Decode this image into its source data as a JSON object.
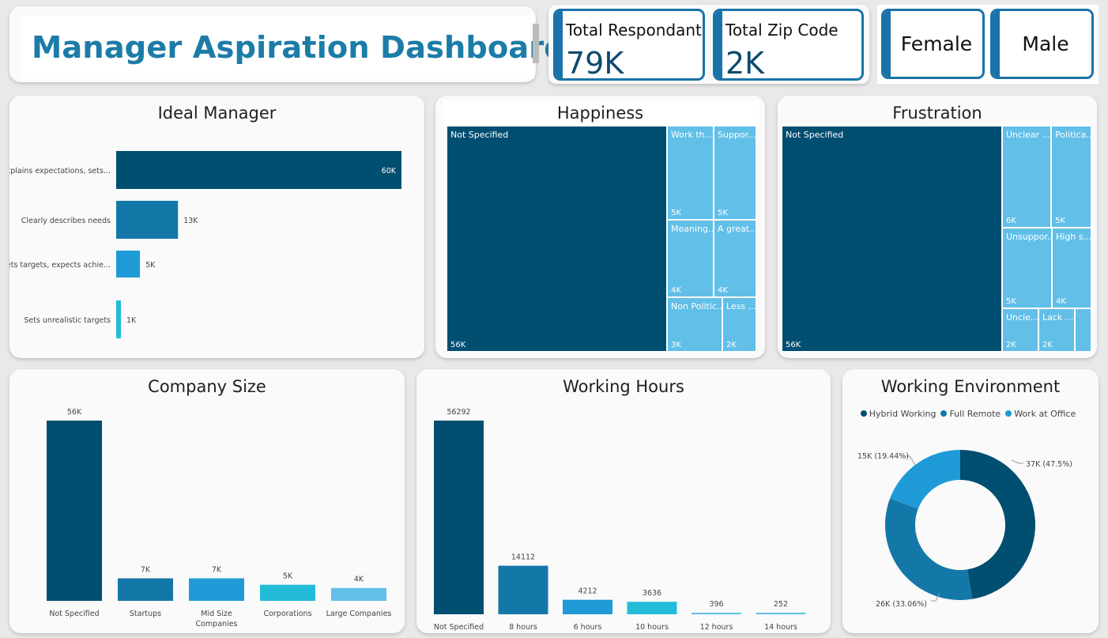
{
  "title": "Manager Aspiration Dashboard",
  "kpis": {
    "respondants": {
      "label": "Total Respondant",
      "value": "79K"
    },
    "zipcodes": {
      "label": "Total Zip Code",
      "value": "2K"
    }
  },
  "filters": {
    "female": "Female",
    "male": "Male"
  },
  "colors": {
    "dark": "#004e70",
    "mid": "#1378a8",
    "light": "#1e9bd6",
    "cyan": "#22bcd8",
    "pale": "#61bfe8",
    "accent": "#1a73a8"
  },
  "ideal_manager": {
    "title": "Ideal Manager",
    "chart_data": {
      "type": "bar",
      "orientation": "horizontal",
      "categories": [
        "Explains expectations, sets...",
        "Clearly describes needs",
        "Sets targets, expects achie...",
        "Sets unrealistic targets"
      ],
      "values": [
        60,
        13,
        5,
        1
      ],
      "labels": [
        "60K",
        "13K",
        "5K",
        "1K"
      ],
      "unit": "K",
      "colors": [
        "#004e70",
        "#1378a8",
        "#1e9bd6",
        "#22bcd8"
      ]
    }
  },
  "happiness": {
    "title": "Happiness",
    "chart_data": {
      "type": "treemap",
      "items": [
        {
          "name": "Not Specified",
          "value": "56K"
        },
        {
          "name": "Work th...",
          "value": "5K"
        },
        {
          "name": "Suppor...",
          "value": "5K"
        },
        {
          "name": "Meaning...",
          "value": "4K"
        },
        {
          "name": "A great...",
          "value": "4K"
        },
        {
          "name": "Non Politic...",
          "value": "3K"
        },
        {
          "name": "Less ...",
          "value": "2K"
        }
      ]
    }
  },
  "frustration": {
    "title": "Frustration",
    "chart_data": {
      "type": "treemap",
      "items": [
        {
          "name": "Not Specified",
          "value": "56K"
        },
        {
          "name": "Unclear ...",
          "value": "6K"
        },
        {
          "name": "Politica...",
          "value": "5K"
        },
        {
          "name": "Unsuppor...",
          "value": "5K"
        },
        {
          "name": "High s...",
          "value": "4K"
        },
        {
          "name": "Uncle...",
          "value": "2K"
        },
        {
          "name": "Lack ...",
          "value": "2K"
        },
        {
          "name": "",
          "value": ""
        }
      ]
    }
  },
  "company_size": {
    "title": "Company Size",
    "chart_data": {
      "type": "bar",
      "categories": [
        "Not Specified",
        "Startups",
        "Mid Size Companies",
        "Corporations",
        "Large Companies"
      ],
      "values": [
        56,
        7,
        7,
        5,
        4
      ],
      "labels": [
        "56K",
        "7K",
        "7K",
        "5K",
        "4K"
      ],
      "unit": "K",
      "colors": [
        "#004e70",
        "#1378a8",
        "#1e9bd6",
        "#22bcd8",
        "#61bfe8"
      ]
    }
  },
  "working_hours": {
    "title": "Working Hours",
    "chart_data": {
      "type": "bar",
      "categories": [
        "Not Specified",
        "8 hours",
        "6 hours",
        "10 hours",
        "12 hours",
        "14 hours"
      ],
      "values": [
        56292,
        14112,
        4212,
        3636,
        396,
        252
      ],
      "labels": [
        "56292",
        "14112",
        "4212",
        "3636",
        "396",
        "252"
      ],
      "colors": [
        "#004e70",
        "#1378a8",
        "#1e9bd6",
        "#22bcd8",
        "#61bfe8",
        "#61bfe8"
      ]
    }
  },
  "working_environment": {
    "title": "Working Environment",
    "chart_data": {
      "type": "pie",
      "donut": true,
      "series": [
        {
          "name": "Hybrid Working",
          "value": 37,
          "label": "37K (47.5%)",
          "color": "#004e70"
        },
        {
          "name": "Full Remote",
          "value": 26,
          "label": "26K (33.06%)",
          "color": "#1378a8"
        },
        {
          "name": "Work at Office",
          "value": 15,
          "label": "15K (19.44%)",
          "color": "#1e9bd6"
        }
      ],
      "legend": "top"
    }
  }
}
